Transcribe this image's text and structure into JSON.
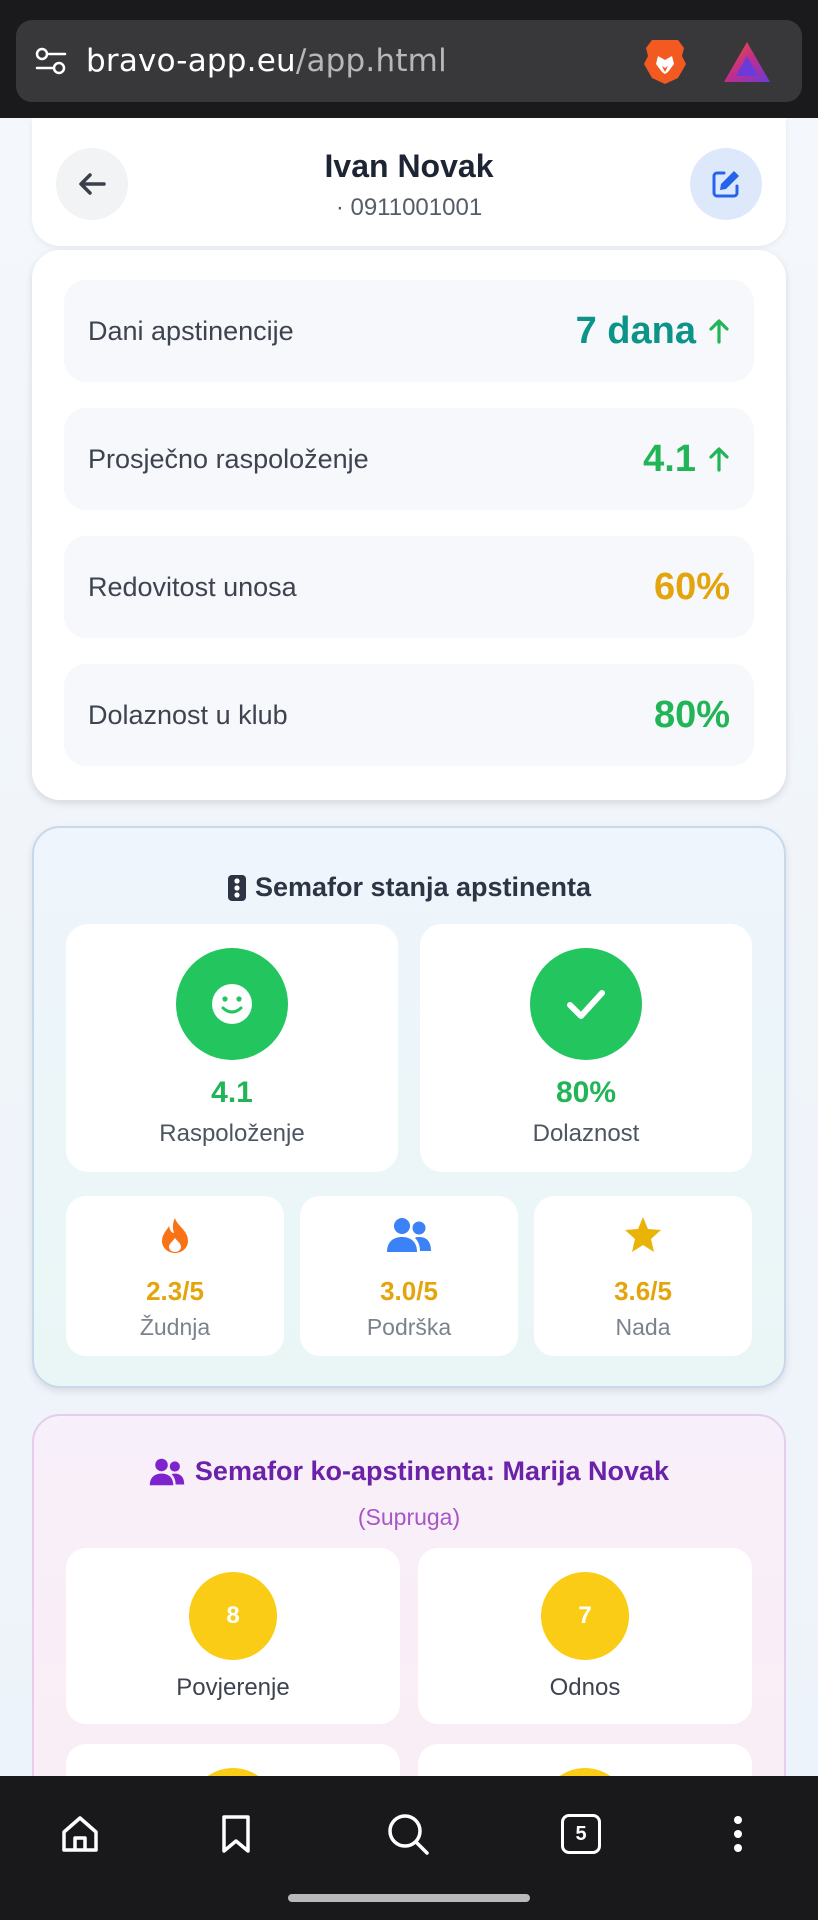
{
  "browser": {
    "url_domain": "bravo-app.eu",
    "url_path": "/app.html",
    "tab_count": "5"
  },
  "header": {
    "name": "Ivan Novak",
    "phone": "· 0911001001"
  },
  "stats": [
    {
      "label": "Dani apstinencije",
      "value": "7 dana",
      "trend": "up",
      "color": "#0d9488"
    },
    {
      "label": "Prosječno raspoloženje",
      "value": "4.1",
      "trend": "up",
      "color": "#22b557"
    },
    {
      "label": "Redovitost unosa",
      "value": "60%",
      "trend": "",
      "color": "#e4a40c"
    },
    {
      "label": "Dolaznost u klub",
      "value": "80%",
      "trend": "",
      "color": "#22b557"
    }
  ],
  "semafor": {
    "title": "Semafor stanja apstinenta",
    "mood": {
      "value": "4.1",
      "label": "Raspoloženje"
    },
    "attendance": {
      "value": "80%",
      "label": "Dolaznost"
    },
    "craving": {
      "value": "2.3/5",
      "label": "Žudnja"
    },
    "support": {
      "value": "3.0/5",
      "label": "Podrška"
    },
    "hope": {
      "value": "3.6/5",
      "label": "Nada"
    }
  },
  "co_semafor": {
    "title": "Semafor ko-apstinenta: Marija Novak",
    "subtitle": "(Supruga)",
    "trust": {
      "value": "8",
      "label": "Povjerenje"
    },
    "relation": {
      "value": "7",
      "label": "Odnos"
    }
  },
  "colors": {
    "green": "#22c55e",
    "teal": "#0d9488",
    "amber": "#e4a40c",
    "purple": "#6b21a8"
  }
}
